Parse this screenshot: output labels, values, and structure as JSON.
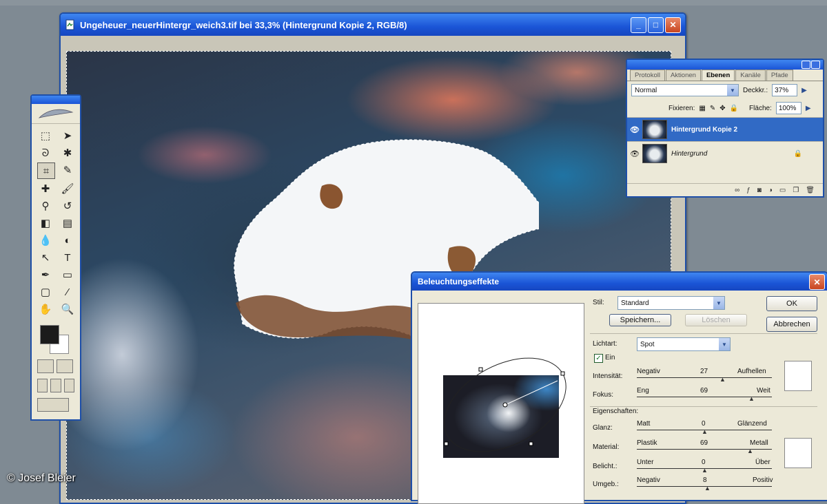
{
  "document": {
    "title": "Ungeheuer_neuerHintergr_weich3.tif bei 33,3% (Hintergrund Kopie 2, RGB/8)"
  },
  "toolbox": {
    "tools": [
      "marquee-icon",
      "move-icon",
      "lasso-icon",
      "magic-wand-icon",
      "crop-icon",
      "slice-icon",
      "healing-icon",
      "brush-icon",
      "stamp-icon",
      "history-brush-icon",
      "eraser-icon",
      "gradient-icon",
      "blur-icon",
      "dodge-icon",
      "path-select-icon",
      "type-icon",
      "pen-icon",
      "shape-icon",
      "notes-icon",
      "eyedropper-icon",
      "hand-icon",
      "zoom-icon"
    ]
  },
  "layers": {
    "tabs": [
      "Protokoll",
      "Aktionen",
      "Ebenen",
      "Kanäle",
      "Pfade"
    ],
    "blend_mode": "Normal",
    "opacity_label": "Deckkr.:",
    "opacity_value": "37%",
    "lock_label": "Fixieren:",
    "fill_label": "Fläche:",
    "fill_value": "100%",
    "items": [
      {
        "name": "Hintergrund Kopie 2"
      },
      {
        "name": "Hintergrund"
      }
    ]
  },
  "dialog": {
    "title": "Beleuchtungseffekte",
    "style_label": "Stil:",
    "style_value": "Standard",
    "save_label": "Speichern...",
    "delete_label": "Löschen",
    "ok_label": "OK",
    "cancel_label": "Abbrechen",
    "light_type_label": "Lichtart:",
    "light_type_value": "Spot",
    "on_label": "Ein",
    "properties_label": "Eigenschaften:",
    "sliders": [
      {
        "label": "Intensität:",
        "left": "Negativ",
        "value": "27",
        "right": "Aufhellen"
      },
      {
        "label": "Fokus:",
        "left": "Eng",
        "value": "69",
        "right": "Weit"
      },
      {
        "label": "Glanz:",
        "left": "Matt",
        "value": "0",
        "right": "Glänzend"
      },
      {
        "label": "Material:",
        "left": "Plastik",
        "value": "69",
        "right": "Metall"
      },
      {
        "label": "Belicht.:",
        "left": "Unter",
        "value": "0",
        "right": "Über"
      },
      {
        "label": "Umgeb.:",
        "left": "Negativ",
        "value": "8",
        "right": "Positiv"
      }
    ]
  },
  "copyright": "© Josef Bleier"
}
